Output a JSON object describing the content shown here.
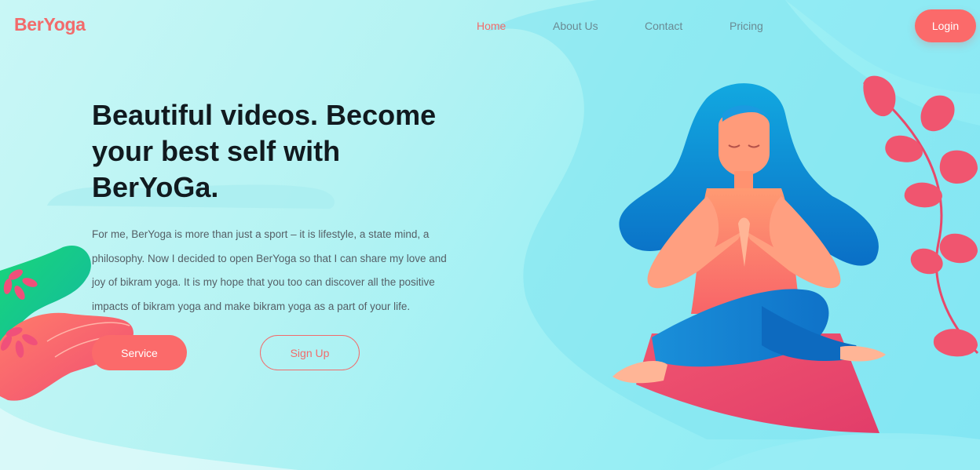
{
  "brand": {
    "name": "BerYoga"
  },
  "nav": {
    "items": [
      {
        "label": "Home",
        "active": true
      },
      {
        "label": "About Us",
        "active": false
      },
      {
        "label": "Contact",
        "active": false
      },
      {
        "label": "Pricing",
        "active": false
      }
    ],
    "login_label": "Login"
  },
  "hero": {
    "headline": "Beautiful videos. Become your best self with BerYoGa.",
    "paragraph": "For me, BerYoga is more than just a sport – it is lifestyle, a state mind, a philosophy. Now I decided to open BerYoga so that I can share my love and joy of bikram yoga. It is my hope that you too can discover all the positive impacts of bikram yoga and make bikram yoga as a part of your life.",
    "service_label": "Service",
    "signup_label": "Sign Up"
  },
  "colors": {
    "accent": "#fb6a6a",
    "nav_text": "#6a8a93",
    "heading": "#111a1f"
  },
  "illustrations": [
    "yoga-woman-illustration",
    "leaf-branch-illustration",
    "plant-blob-illustration"
  ]
}
